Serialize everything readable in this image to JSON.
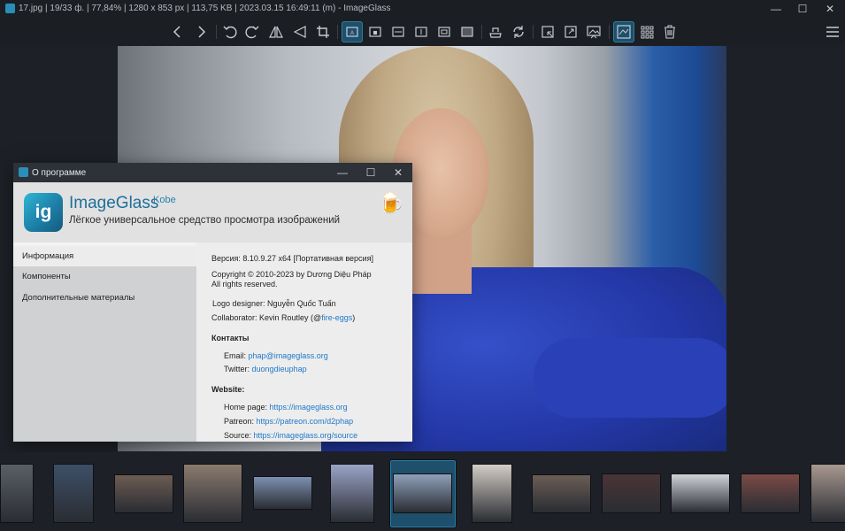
{
  "window": {
    "title": "17.jpg  |  19/33 ф.  |  77,84%  |  1280 x 853 px  |  113,75 KB  |  2023.03.15 16:49:11 (m)  - ImageGlass",
    "controls": [
      "—",
      "☐",
      "✕"
    ]
  },
  "toolbar": {
    "buttons": [
      {
        "name": "previous-image",
        "icon": "chevron-left-icon"
      },
      {
        "name": "next-image",
        "icon": "chevron-right-icon"
      },
      {
        "name": "rotate-left",
        "icon": "rotate-left-icon"
      },
      {
        "name": "rotate-right",
        "icon": "rotate-right-icon"
      },
      {
        "name": "flip-horizontal",
        "icon": "flip-horizontal-icon"
      },
      {
        "name": "flip-vertical",
        "icon": "flip-vertical-icon"
      },
      {
        "name": "crop",
        "icon": "crop-icon"
      },
      {
        "name": "auto-zoom",
        "icon": "auto-zoom-icon",
        "active": true
      },
      {
        "name": "lock-zoom",
        "icon": "lock-zoom-icon"
      },
      {
        "name": "scale-to-width",
        "icon": "scale-width-icon"
      },
      {
        "name": "scale-to-height",
        "icon": "scale-height-icon"
      },
      {
        "name": "scale-to-fit",
        "icon": "scale-fit-icon"
      },
      {
        "name": "scale-to-fill",
        "icon": "scale-fill-icon"
      },
      {
        "name": "open-with",
        "icon": "open-with-icon"
      },
      {
        "name": "refresh",
        "icon": "refresh-icon"
      },
      {
        "name": "window-fit",
        "icon": "window-fit-icon"
      },
      {
        "name": "full-screen",
        "icon": "full-screen-icon"
      },
      {
        "name": "slideshow",
        "icon": "slideshow-icon"
      },
      {
        "name": "thumbnail-bar",
        "icon": "thumbnail-bar-icon",
        "active": true
      },
      {
        "name": "gallery",
        "icon": "grid-icon"
      },
      {
        "name": "delete",
        "icon": "trash-icon"
      },
      {
        "name": "main-menu",
        "icon": "hamburger-menu-icon"
      }
    ]
  },
  "dialog": {
    "title": "О программе",
    "controls": [
      "—",
      "☐",
      "✕"
    ],
    "app_name": "ImageGlass",
    "app_codename": "Kobe",
    "app_description": "Лёгкое универсальное средство просмотра изображений",
    "logo_text": "ig",
    "donate_icon": "🍺",
    "sidebar": [
      {
        "label": "Информация",
        "active": true
      },
      {
        "label": "Компоненты",
        "active": false
      },
      {
        "label": "Дополнительные материалы",
        "active": false
      }
    ],
    "info": {
      "version": "Версия: 8.10.9.27 x64 [Портативная версия]",
      "copyright": "Copyright © 2010-2023 by Dương Diệu Pháp",
      "rights": "All rights reserved.",
      "logo_designer": "Logo designer: Nguyễn Quốc Tuấn",
      "collaborator_prefix": "Collaborator: Kevin Routley (@",
      "collaborator_link": "fire-eggs",
      "collaborator_suffix": ")",
      "contacts_heading": "Контакты",
      "email_label": "Email:",
      "email_value": "phap@imageglass.org",
      "twitter_label": "Twitter:",
      "twitter_value": "duongdieuphap",
      "website_heading": "Website:",
      "homepage_label": "Home page:",
      "homepage_value": "https://imageglass.org",
      "patreon_label": "Patreon:",
      "patreon_value": "https://patreon.com/d2phap",
      "source_label": "Source:",
      "source_value": "https://imageglass.org/source"
    }
  },
  "thumbnails": {
    "count_visible": 13,
    "selected_index": 6,
    "tones": [
      "#5a5f66",
      "#3d4f66",
      "#6d5c52",
      "#8a7a6e",
      "#7c8fb0",
      "#9aa3c7",
      "#8fa0b8",
      "#d2ccc4",
      "#6b5d55",
      "#4a3536",
      "#cfd3d8",
      "#7a4a46",
      "#a89890"
    ]
  }
}
